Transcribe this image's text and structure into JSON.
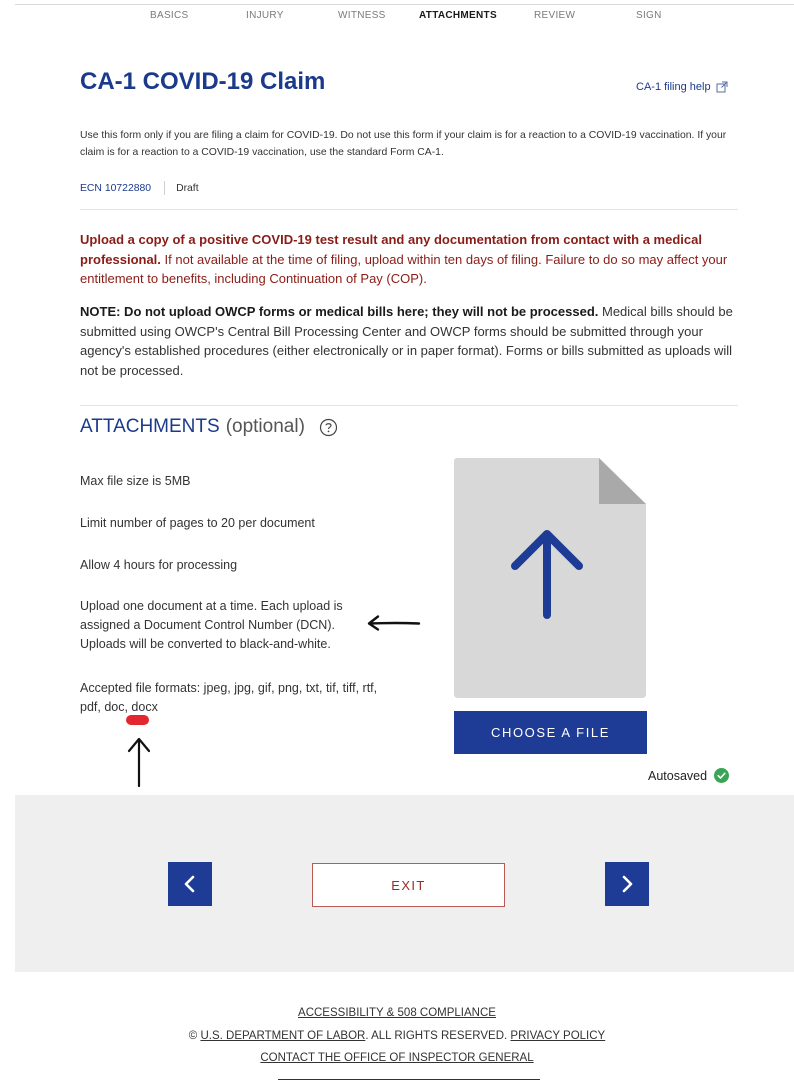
{
  "steps": [
    "BASICS",
    "INJURY",
    "WITNESS",
    "ATTACHMENTS",
    "REVIEW",
    "SIGN"
  ],
  "active_step": "ATTACHMENTS",
  "header": {
    "title": "CA-1 COVID-19 Claim",
    "help_link": "CA-1 filing help"
  },
  "intro": "Use this form only if you are filing a claim for COVID-19. Do not use this form if your claim is for a reaction to a COVID-19 vaccination. If your claim is for a reaction to a COVID-19 vaccination, use the standard Form CA-1.",
  "ecn": {
    "number": "ECN 10722880",
    "status": "Draft"
  },
  "warning": {
    "bold": "Upload a copy of a positive COVID-19 test result and any documentation from contact with a medical professional.",
    "rest": " If not available at the time of filing, upload within ten days of filing. Failure to do so may affect your entitlement to benefits, including Continuation of Pay (COP)."
  },
  "note": {
    "bold": "NOTE: Do not upload OWCP forms or medical bills here; they will not be processed.",
    "rest": " Medical bills should be submitted using OWCP's Central Bill Processing Center and OWCP forms should be submitted through your agency's established procedures (either electronically or in paper format). Forms or bills submitted as uploads will not be processed."
  },
  "attachments": {
    "title": "ATTACHMENTS",
    "optional": "(optional)",
    "max_size": "Max file size is 5MB",
    "page_limit": "Limit number of pages to 20 per document",
    "processing": "Allow 4 hours for processing",
    "upload_info": "Upload one document at a time. Each upload is assigned a Document Control Number (DCN). Uploads will be converted to black-and-white.",
    "formats": "Accepted file formats: jpeg, jpg, gif, png, txt, tif, tiff, rtf, pdf, doc, docx",
    "choose_label": "CHOOSE A FILE",
    "autosaved": "Autosaved"
  },
  "nav": {
    "exit_label": "EXIT"
  },
  "footer": {
    "accessibility": "ACCESSIBILITY & 508 COMPLIANCE",
    "copyright_symbol": "©",
    "dol": "U.S. DEPARTMENT OF LABOR",
    "rights": ". ALL RIGHTS RESERVED.",
    "privacy": "PRIVACY POLICY",
    "contact": "CONTACT THE OFFICE OF INSPECTOR GENERAL"
  },
  "colors": {
    "primary": "#1e3c96",
    "heading": "#1b3a8c",
    "warning": "#8a1c17",
    "success": "#3aa655",
    "annotation_red": "#e2272f"
  },
  "icons": [
    "external-link-icon",
    "help-circle-icon",
    "upload-arrow-icon",
    "check-circle-icon",
    "chevron-left-icon",
    "chevron-right-icon"
  ]
}
